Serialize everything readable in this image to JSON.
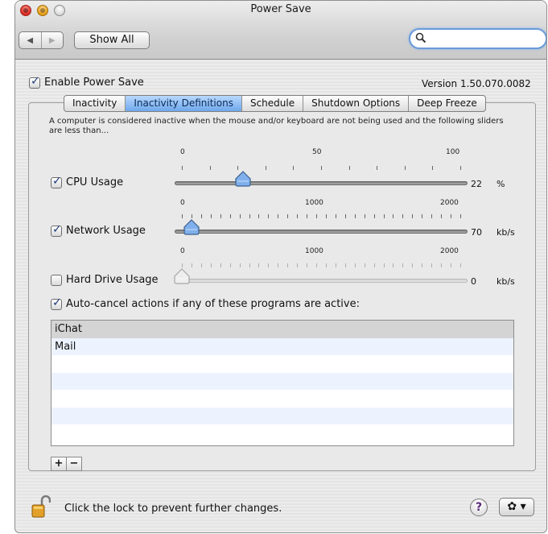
{
  "window": {
    "title": "Power Save"
  },
  "toolbar": {
    "back_icon": "◀",
    "forward_icon": "▶",
    "show_all_label": "Show All",
    "search_value": "",
    "search_icon": "🔍"
  },
  "enable": {
    "label": "Enable Power Save",
    "checked": true
  },
  "version": "Version 1.50.070.0082",
  "tabs": [
    {
      "label": "Inactivity",
      "active": false
    },
    {
      "label": "Inactivity Definitions",
      "active": true
    },
    {
      "label": "Schedule",
      "active": false
    },
    {
      "label": "Shutdown Options",
      "active": false
    },
    {
      "label": "Deep Freeze",
      "active": false
    }
  ],
  "description": "A computer is considered inactive when the mouse and/or keyboard are not being used and the following sliders are less than...",
  "sliders": [
    {
      "label": "CPU Usage",
      "checked": true,
      "enabled": true,
      "min": 0,
      "mid": 50,
      "max": 100,
      "min_label": "0",
      "mid_label": "50",
      "max_label": "100",
      "value": 22,
      "value_label": "22",
      "unit": "%"
    },
    {
      "label": "Network Usage",
      "checked": true,
      "enabled": true,
      "min": 0,
      "mid": 1000,
      "max": 2000,
      "min_label": "0",
      "mid_label": "1000",
      "max_label": "2000",
      "value": 70,
      "value_label": "70",
      "unit": "kb/s"
    },
    {
      "label": "Hard Drive Usage",
      "checked": false,
      "enabled": false,
      "min": 0,
      "mid": 1000,
      "max": 2000,
      "min_label": "0",
      "mid_label": "1000",
      "max_label": "2000",
      "value": 0,
      "value_label": "0",
      "unit": "kb/s"
    }
  ],
  "auto_cancel": {
    "label": "Auto-cancel actions if any of these programs are active:",
    "checked": true
  },
  "programs": [
    "iChat",
    "Mail"
  ],
  "list_buttons": {
    "add": "+",
    "remove": "−"
  },
  "footer": {
    "lock_text": "Click the lock to prevent further changes.",
    "help_label": "?",
    "gear_label": "✿ ▾"
  }
}
